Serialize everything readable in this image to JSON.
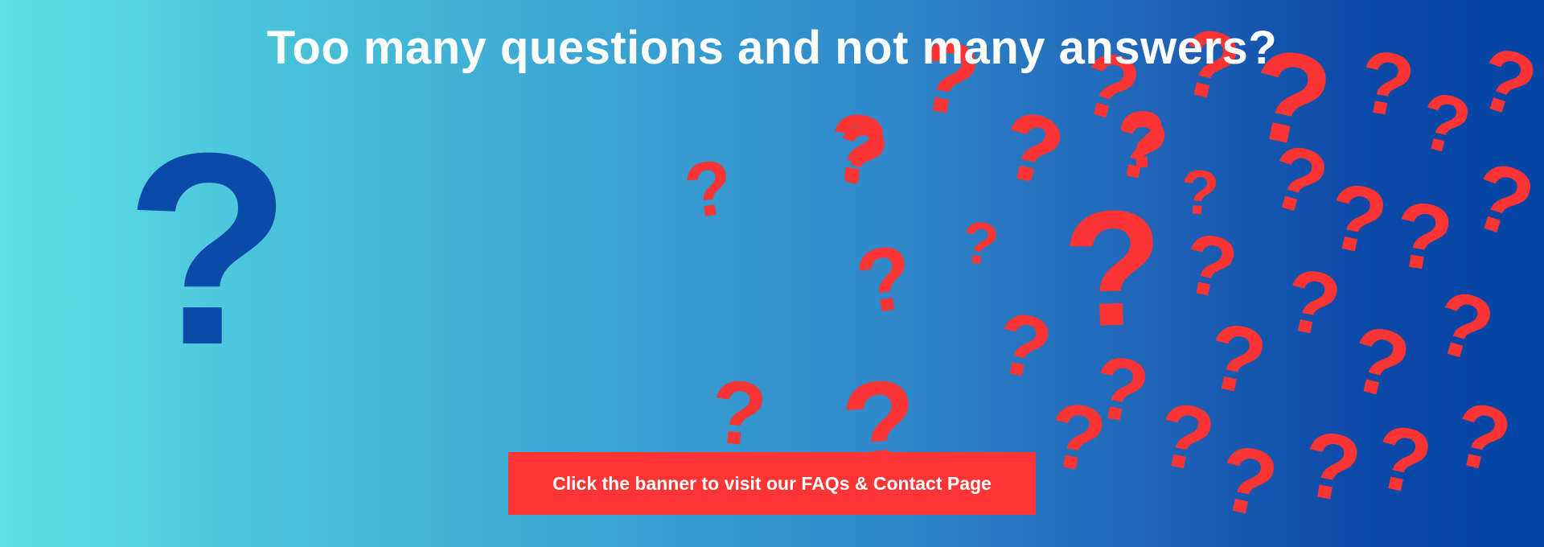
{
  "banner": {
    "headline": "Too many questions and not many answers?",
    "cta_label": "Click the banner to visit our FAQs & Contact Page",
    "main_symbol": "?",
    "red_symbol": "?",
    "colors": {
      "gradient_start": "#5fe0e3",
      "gradient_end": "#0444a3",
      "main_symbol": "#0a4aa9",
      "red_symbols": "#fb3434",
      "button": "#ff3535",
      "text": "#ffffff"
    }
  }
}
